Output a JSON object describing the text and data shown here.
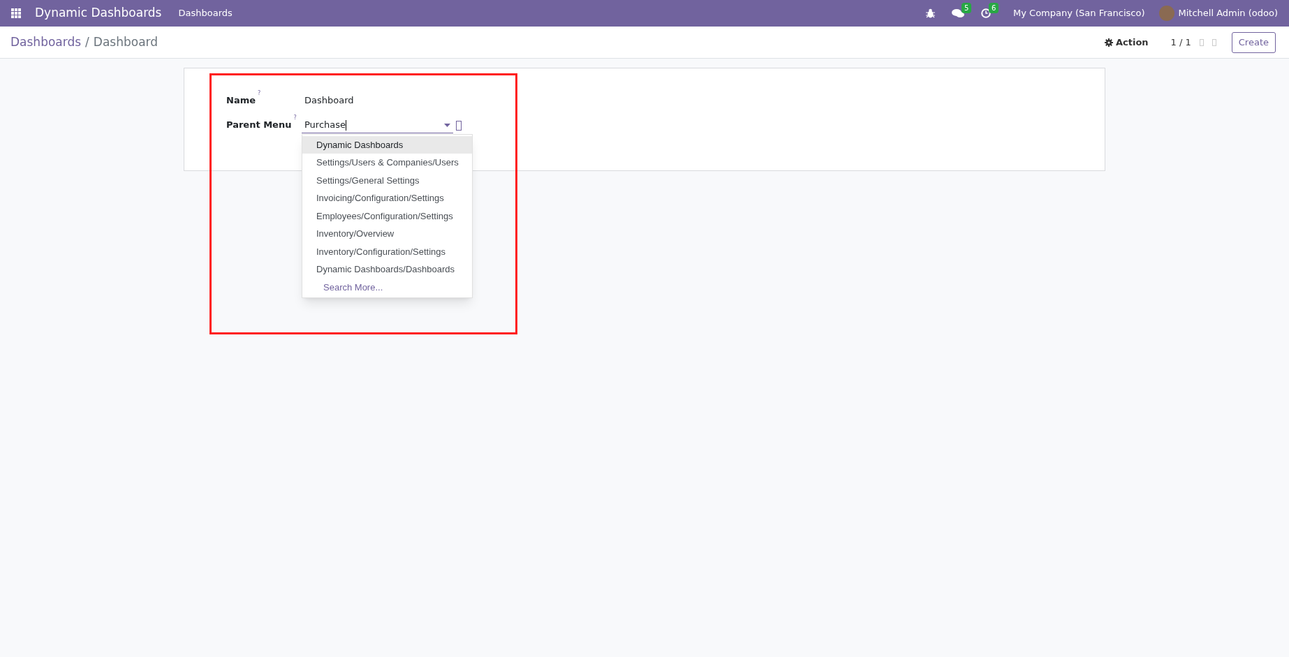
{
  "navbar": {
    "app_title": "Dynamic Dashboards",
    "menu": [
      "Dashboards"
    ],
    "messages_count": "5",
    "activities_count": "6",
    "company": "My Company (San Francisco)",
    "user": "Mitchell Admin (odoo)"
  },
  "control_panel": {
    "breadcrumb": [
      {
        "label": "Dashboards",
        "kind": "link"
      },
      {
        "label": "/",
        "kind": "separator"
      },
      {
        "label": "Dashboard",
        "kind": "current"
      }
    ],
    "action": "Action",
    "pager": "1 / 1",
    "create": "Create"
  },
  "form": {
    "fields": [
      {
        "label": "Name",
        "help": "?",
        "value": "Dashboard",
        "kind": "text"
      },
      {
        "label": "Parent Menu",
        "help": "?",
        "value": "Purchase",
        "kind": "many2one"
      }
    ]
  },
  "dropdown": {
    "items": [
      {
        "label": "Dynamic Dashboards",
        "selected": true
      },
      {
        "label": "Settings/Users & Companies/Users",
        "selected": false
      },
      {
        "label": "Settings/General Settings",
        "selected": false
      },
      {
        "label": "Invoicing/Configuration/Settings",
        "selected": false
      },
      {
        "label": "Employees/Configuration/Settings",
        "selected": false
      },
      {
        "label": "Inventory/Overview",
        "selected": false
      },
      {
        "label": "Inventory/Configuration/Settings",
        "selected": false
      },
      {
        "label": "Dynamic Dashboards/Dashboards",
        "selected": false
      }
    ],
    "search_more": "Search More..."
  }
}
